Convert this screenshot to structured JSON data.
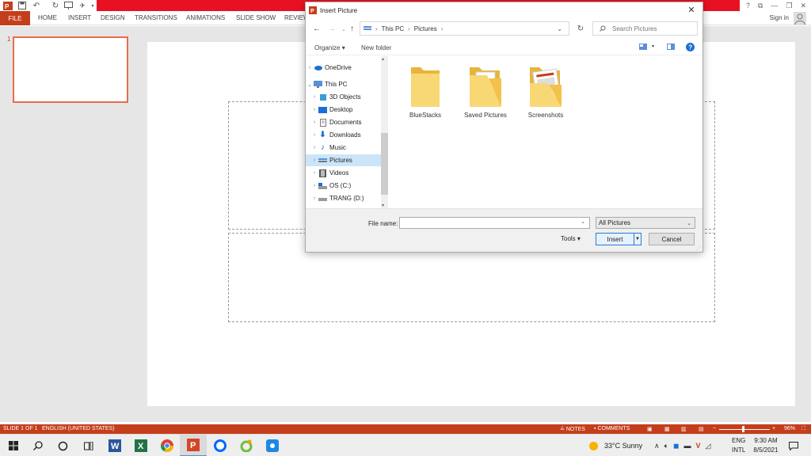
{
  "ribbon": {
    "file_tab": "FILE",
    "tabs": [
      "HOME",
      "INSERT",
      "DESIGN",
      "TRANSITIONS",
      "ANIMATIONS",
      "SLIDE SHOW",
      "REVIEW"
    ],
    "sign_in": "Sign in",
    "window_help": "?"
  },
  "thumbnails": {
    "slide_number": "1"
  },
  "dialog": {
    "title": "Insert Picture",
    "breadcrumb": [
      "This PC",
      "Pictures"
    ],
    "search_placeholder": "Search Pictures",
    "organize": "Organize",
    "new_folder": "New folder",
    "nav_items": [
      {
        "label": "OneDrive",
        "icon": "cloud-icon"
      },
      {
        "label": "This PC",
        "icon": "computer-icon"
      },
      {
        "label": "3D Objects",
        "icon": "cube-icon"
      },
      {
        "label": "Desktop",
        "icon": "desktop-icon"
      },
      {
        "label": "Documents",
        "icon": "document-icon"
      },
      {
        "label": "Downloads",
        "icon": "download-icon"
      },
      {
        "label": "Music",
        "icon": "music-note-icon"
      },
      {
        "label": "Pictures",
        "icon": "picture-icon"
      },
      {
        "label": "Videos",
        "icon": "film-icon"
      },
      {
        "label": "OS (C:)",
        "icon": "drive-icon"
      },
      {
        "label": "TRANG (D:)",
        "icon": "drive-icon"
      }
    ],
    "selected_nav": "Pictures",
    "folders": [
      "BlueStacks",
      "Saved Pictures",
      "Screenshots"
    ],
    "file_name_label": "File name:",
    "file_name_value": "",
    "filter": "All Pictures",
    "tools": "Tools",
    "insert": "Insert",
    "cancel": "Cancel"
  },
  "statusbar": {
    "slide": "SLIDE 1 OF 1",
    "language": "ENGLISH (UNITED STATES)",
    "notes": "NOTES",
    "comments": "COMMENTS",
    "zoom": "96%"
  },
  "taskbar": {
    "weather": "33°C  Sunny",
    "lang_top": "ENG",
    "lang_bottom": "INTL",
    "time": "9:30 AM",
    "date": "8/5/2021"
  },
  "colors": {
    "accent": "#c43e1c",
    "title_red": "#e81123",
    "selection": "#cce4f7",
    "folder": "#f8d775"
  }
}
